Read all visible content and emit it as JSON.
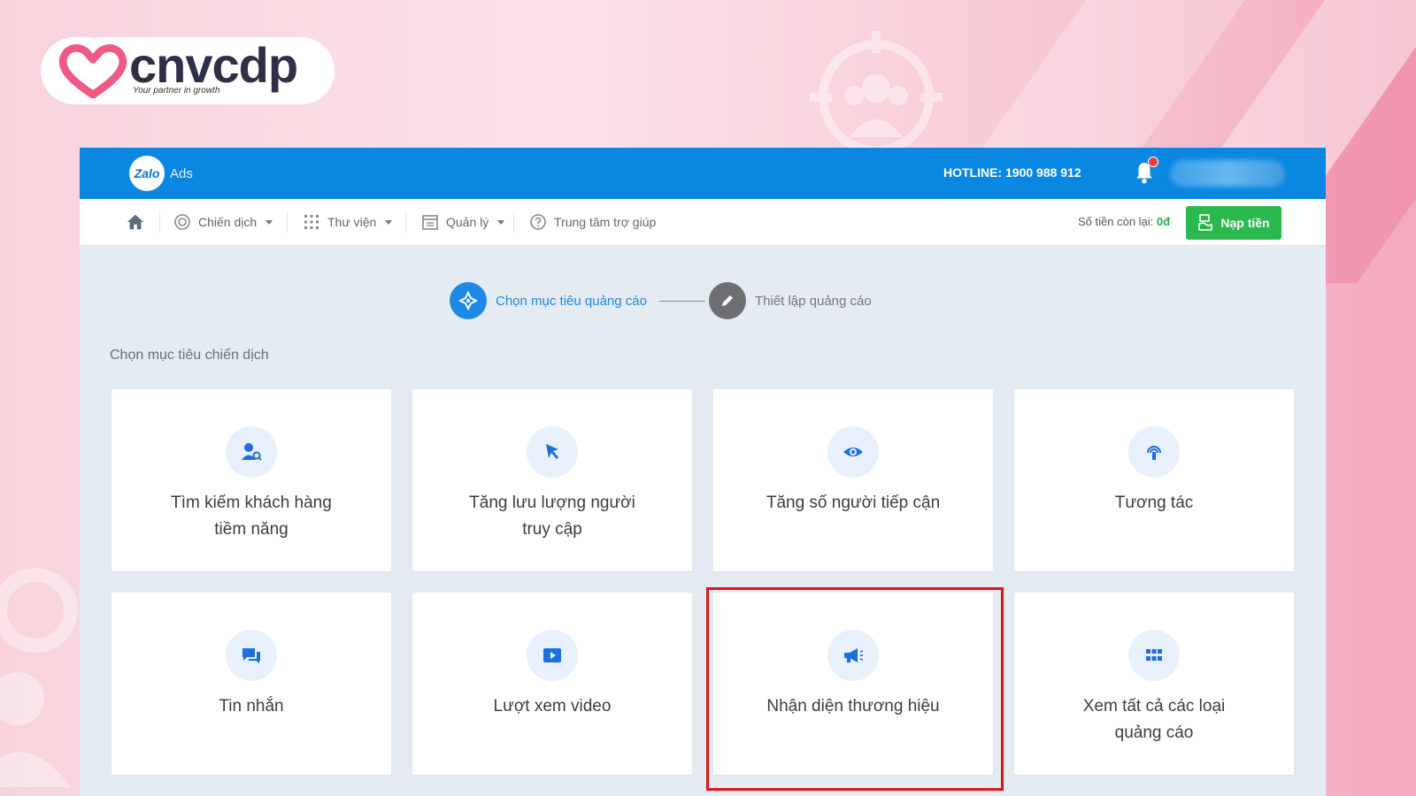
{
  "brand": {
    "name": "cnvcdp",
    "tagline": "Your partner in growth",
    "accent": "#ee5a83"
  },
  "topbar": {
    "logo_text": "Zalo",
    "product": "Ads",
    "hotline": "HOTLINE: 1900 988 912",
    "color": "#0a87e0"
  },
  "nav": {
    "items": [
      {
        "label": "Chiến dịch",
        "icon": "target-icon",
        "dropdown": true
      },
      {
        "label": "Thư viện",
        "icon": "grid-icon",
        "dropdown": true
      },
      {
        "label": "Quản lý",
        "icon": "calendar-icon",
        "dropdown": true
      },
      {
        "label": "Trung tâm trợ giúp",
        "icon": "help-icon",
        "dropdown": false
      }
    ],
    "balance_label": "Số tiền còn lại:",
    "balance_value": "0đ",
    "topup_label": "Nạp tiền"
  },
  "steps": [
    {
      "label": "Chọn mục tiêu quảng cáo",
      "active": true
    },
    {
      "label": "Thiết lập quảng cáo",
      "active": false
    }
  ],
  "section_title": "Chọn mục tiêu chiến dịch",
  "objectives": [
    {
      "line1": "Tìm kiếm khách hàng",
      "line2": "tiềm năng",
      "icon": "user-search-icon"
    },
    {
      "line1": "Tăng lưu lượng người",
      "line2": "truy cập",
      "icon": "cursor-icon"
    },
    {
      "line1": "Tăng số người tiếp cận",
      "line2": "",
      "icon": "eye-icon"
    },
    {
      "line1": "Tương tác",
      "line2": "",
      "icon": "broadcast-icon"
    },
    {
      "line1": "Tin nhắn",
      "line2": "",
      "icon": "chat-icon"
    },
    {
      "line1": "Lượt xem video",
      "line2": "",
      "icon": "video-icon"
    },
    {
      "line1": "Nhận diện thương hiệu",
      "line2": "",
      "icon": "megaphone-icon",
      "highlighted": true
    },
    {
      "line1": "Xem tất cả các loại",
      "line2": "quảng cáo",
      "icon": "apps-icon"
    }
  ],
  "colors": {
    "primary": "#1e88e5",
    "success": "#2bb84f",
    "highlight": "#e01616"
  }
}
